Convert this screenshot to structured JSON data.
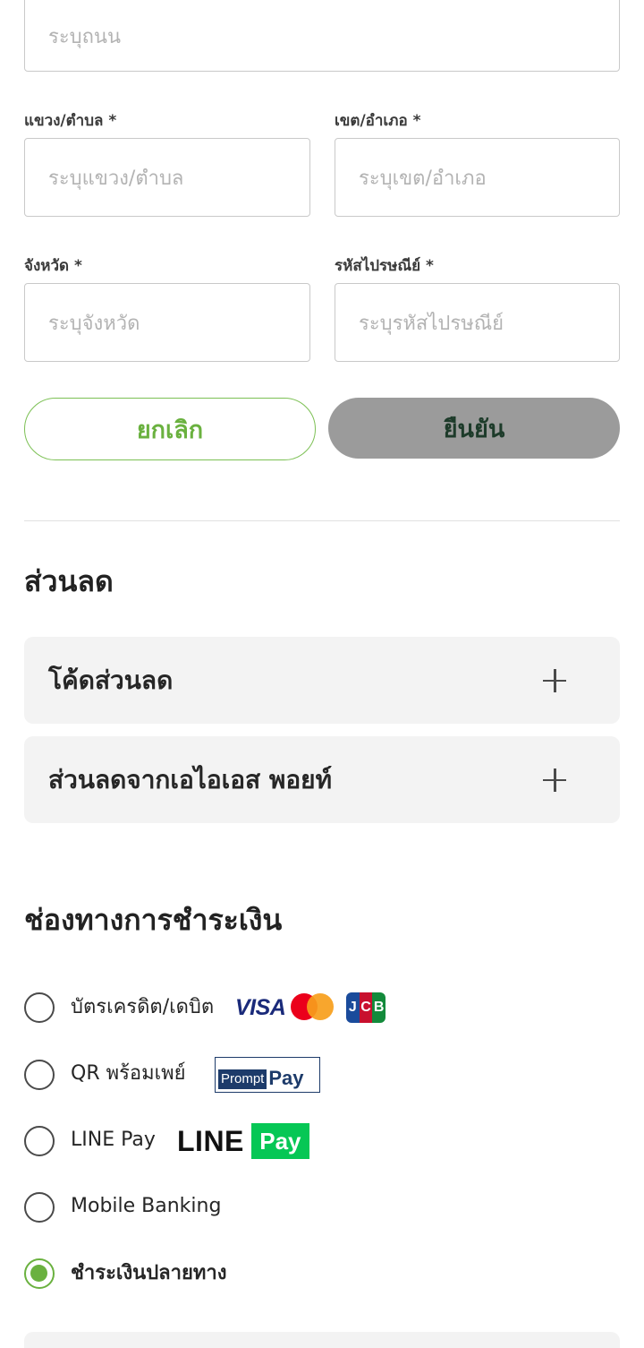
{
  "address_form": {
    "street_placeholder": "ระบุถนน",
    "subdistrict_label": "แขวง/ตำบล *",
    "subdistrict_placeholder": "ระบุแขวง/ตำบล",
    "district_label": "เขต/อำเภอ *",
    "district_placeholder": "ระบุเขต/อำเภอ",
    "province_label": "จังหวัด *",
    "province_placeholder": "ระบุจังหวัด",
    "postcode_label": "รหัสไปรษณีย์ *",
    "postcode_placeholder": "ระบุรหัสไปรษณีย์",
    "cancel_label": "ยกเลิก",
    "confirm_label": "ยืนยัน"
  },
  "discount": {
    "title": "ส่วนลด",
    "items": [
      {
        "label": "โค้ดส่วนลด"
      },
      {
        "label": "ส่วนลดจากเอไอเอส พอยท์"
      }
    ]
  },
  "payment": {
    "title": "ช่องทางการชำระเงิน",
    "methods": [
      {
        "label": "บัตรเครดิต/เดบิต",
        "selected": false,
        "logos": [
          "visa",
          "mastercard",
          "jcb"
        ]
      },
      {
        "label": "QR พร้อมเพย์",
        "selected": false,
        "logos": [
          "promptpay"
        ]
      },
      {
        "label": "LINE Pay",
        "selected": false,
        "logos": [
          "line-pay"
        ]
      },
      {
        "label": "Mobile Banking",
        "selected": false,
        "logos": []
      },
      {
        "label": "ชำระเงินปลายทาง",
        "selected": true,
        "logos": []
      }
    ],
    "logo_text": {
      "visa": "VISA",
      "jcb": [
        "J",
        "C",
        "B"
      ],
      "promptpay_a": "Prompt",
      "promptpay_b": "Pay",
      "line_word": "LINE",
      "line_pay": "Pay"
    }
  },
  "colors": {
    "accent_green": "#6ab13f",
    "confirm_disabled": "#9b9b9b",
    "line_green": "#06c755",
    "visa_blue": "#1a2a7a",
    "mastercard_red": "#eb001b",
    "mastercard_orange": "#f79e1b"
  }
}
